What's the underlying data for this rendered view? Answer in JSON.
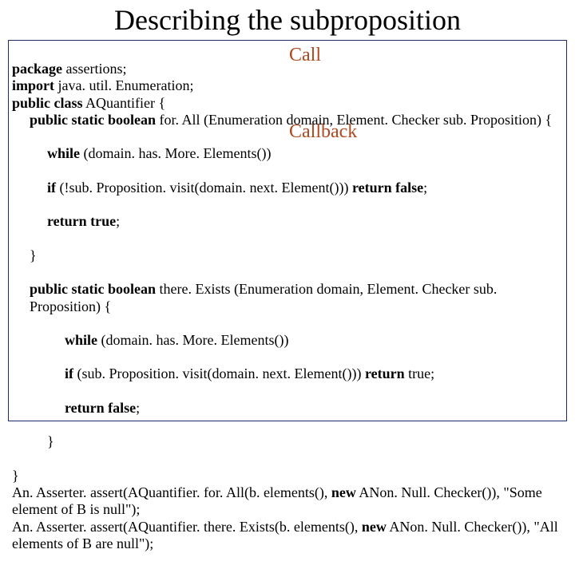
{
  "title": "Describing the subproposition",
  "annotations": {
    "call": "Call",
    "callback": "Callback"
  },
  "code": {
    "l1a": "package",
    "l1b": " assertions;",
    "l2a": "import",
    "l2b": " java. util. Enumeration;",
    "l3a": "public class",
    "l3b": " AQuantifier {",
    "l4a": "public static boolean",
    "l4b": " for. All (Enumeration domain, Element. Checker sub. Proposition) {",
    "l5a": "while",
    "l5b": " (domain. has. More. Elements())",
    "l6a": "if",
    "l6b": " (!sub. Proposition. visit(domain. next. Element())) ",
    "l6c": "return false",
    "l6d": ";",
    "l7a": "return true",
    "l7b": ";",
    "l8": "}",
    "l9a": "public static boolean",
    "l9b": " there. Exists (Enumeration domain, Element. Checker sub. Proposition) {",
    "l10a": "while",
    "l10b": " (domain. has. More. Elements())",
    "l11a": "if",
    "l11b": " (sub. Proposition. visit(domain. next. Element())) ",
    "l11c": "return",
    "l11d": " true;",
    "l12a": "return false",
    "l12b": ";",
    "l13": "}",
    "l14": "}",
    "l15a": "An. Asserter. assert(AQuantifier. for. All(b. elements(), ",
    "l15b": "new",
    "l15c": " ANon. Null. Checker()), \"Some element of B is null\");",
    "l16a": "An. Asserter. assert(AQuantifier. there. Exists(b. elements(), ",
    "l16b": "new",
    "l16c": " ANon. Null. Checker()), \"All elements of B are null\");"
  }
}
